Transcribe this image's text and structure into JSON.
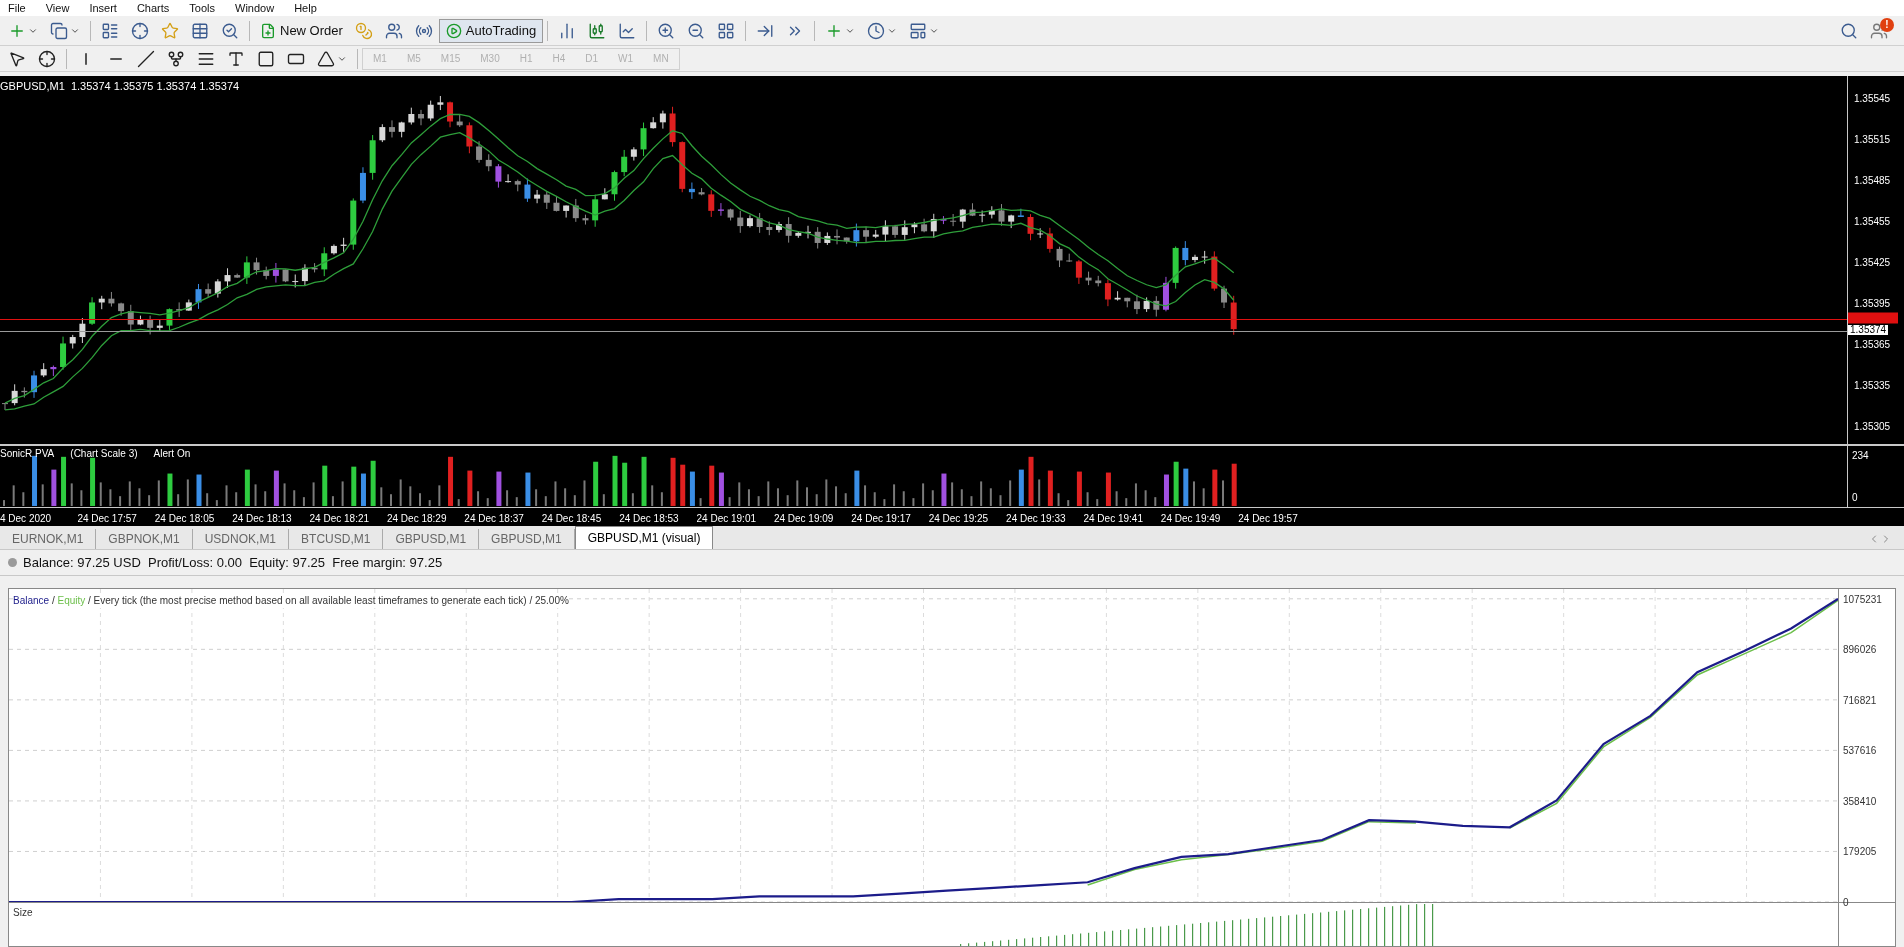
{
  "menu": [
    "File",
    "View",
    "Insert",
    "Charts",
    "Tools",
    "Window",
    "Help"
  ],
  "toolbar": {
    "new_order": "New Order",
    "auto_trading": {
      "label": "AutoTrading",
      "active": true
    }
  },
  "timeframes": [
    {
      "label": "M1",
      "disabled": true
    },
    {
      "label": "M5",
      "disabled": true
    },
    {
      "label": "M15",
      "disabled": true
    },
    {
      "label": "M30",
      "disabled": true
    },
    {
      "label": "H1",
      "disabled": true
    },
    {
      "label": "H4",
      "disabled": true
    },
    {
      "label": "D1",
      "disabled": true
    },
    {
      "label": "W1",
      "disabled": true
    },
    {
      "label": "MN",
      "disabled": true
    }
  ],
  "notifications": {
    "badge": "!"
  },
  "chart": {
    "header": "GBPUSD,M1  1.35374 1.35375 1.35374 1.35374",
    "price_ticks": [
      "1.35545",
      "1.35515",
      "1.35485",
      "1.35455",
      "1.35425",
      "1.35395",
      "1.35365",
      "1.35335",
      "1.35305"
    ],
    "current_price": "1.35374",
    "indicator": {
      "title": "SonicR PVA",
      "scale": "(Chart Scale 3)",
      "alert": "Alert On",
      "max_label": "234",
      "min_label": "0"
    },
    "time_labels": [
      "4 Dec 2020",
      "24 Dec 17:57",
      "24 Dec 18:05",
      "24 Dec 18:13",
      "24 Dec 18:21",
      "24 Dec 18:29",
      "24 Dec 18:37",
      "24 Dec 18:45",
      "24 Dec 18:53",
      "24 Dec 19:01",
      "24 Dec 19:09",
      "24 Dec 19:17",
      "24 Dec 19:25",
      "24 Dec 19:33",
      "24 Dec 19:41",
      "24 Dec 19:49",
      "24 Dec 19:57"
    ]
  },
  "tabs": [
    {
      "label": "EURNOK,M1",
      "selected": false
    },
    {
      "label": "GBPNOK,M1",
      "selected": false
    },
    {
      "label": "USDNOK,M1",
      "selected": false
    },
    {
      "label": "BTCUSD,M1",
      "selected": false
    },
    {
      "label": "GBPUSD,M1",
      "selected": false
    },
    {
      "label": "GBPUSD,M1",
      "selected": false
    },
    {
      "label": "GBPUSD,M1 (visual)",
      "selected": true
    }
  ],
  "account_line": "Balance: 97.25 USD  Profit/Loss: 0.00  Equity: 97.25  Free margin: 97.25",
  "graph": {
    "separator": "/",
    "description": "/ Every tick (the most precise method based on all available least timeframes to generate each tick) / 25.00%",
    "size_label": "Size",
    "chart_data": {
      "type": "line",
      "series": [
        {
          "name": "Balance",
          "color": "#1c1c8a",
          "values": [
            0,
            0,
            0,
            0,
            0,
            0,
            0,
            0,
            0,
            0,
            0,
            0,
            0,
            10000,
            10000,
            10000,
            20000,
            20000,
            20000,
            30000,
            40000,
            50000,
            60000,
            70000,
            120000,
            160000,
            170000,
            195000,
            220000,
            290000,
            285000,
            270000,
            265000,
            360000,
            560000,
            660000,
            815000,
            890000,
            970000,
            1075000
          ]
        },
        {
          "name": "Equity",
          "color": "#6cbf4a",
          "values": [
            null,
            null,
            null,
            null,
            null,
            null,
            null,
            null,
            null,
            null,
            null,
            null,
            null,
            null,
            null,
            null,
            null,
            null,
            null,
            null,
            null,
            null,
            null,
            60000,
            115000,
            150000,
            168000,
            190000,
            215000,
            285000,
            280000,
            null,
            262000,
            350000,
            550000,
            655000,
            805000,
            880000,
            955000,
            1070000
          ]
        }
      ],
      "ylim": [
        0,
        1110000
      ],
      "grid": true,
      "yticks": [
        {
          "value": 0,
          "label": "0"
        },
        {
          "value": 179205,
          "label": "179205"
        },
        {
          "value": 358410,
          "label": "358410"
        },
        {
          "value": 537616,
          "label": "537616"
        },
        {
          "value": 716821,
          "label": "716821"
        },
        {
          "value": 896026,
          "label": "896026"
        },
        {
          "value": 1075231,
          "label": "1075231"
        }
      ]
    }
  }
}
